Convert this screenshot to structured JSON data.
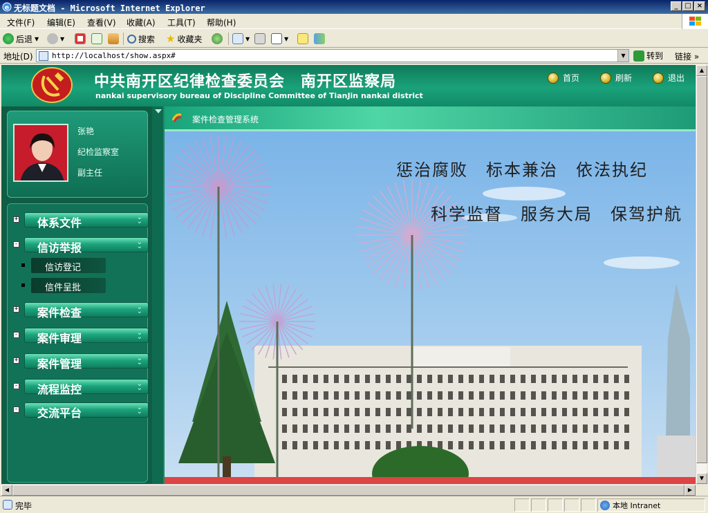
{
  "window": {
    "title": "无标题文档 - Microsoft Internet Explorer",
    "min": "_",
    "max": "□",
    "close": "×"
  },
  "menu": [
    "文件(F)",
    "编辑(E)",
    "查看(V)",
    "收藏(A)",
    "工具(T)",
    "帮助(H)"
  ],
  "toolbar": {
    "back": "后退",
    "search": "搜索",
    "favorites": "收藏夹"
  },
  "address": {
    "label": "地址(D)",
    "url": "http://localhost/show.aspx#",
    "go": "转到",
    "links": "链接"
  },
  "header": {
    "title_cn": "中共南开区纪律检查委员会　南开区监察局",
    "title_en": "nankai supervisory bureau of Discipline Committee of TianJin nankai district",
    "nav": [
      "首页",
      "刷新",
      "退出"
    ]
  },
  "profile": {
    "name": "张艳",
    "department": "纪检监察室",
    "position": "副主任"
  },
  "nav_categories": [
    {
      "label": "体系文件",
      "toggle": "+"
    },
    {
      "label": "信访举报",
      "toggle": "-"
    },
    {
      "label": "案件检查",
      "toggle": "+"
    },
    {
      "label": "案件审理",
      "toggle": "-"
    },
    {
      "label": "案件管理",
      "toggle": "+"
    },
    {
      "label": "流程监控",
      "toggle": "-"
    },
    {
      "label": "交流平台",
      "toggle": "-"
    }
  ],
  "nav_subitems": [
    "信访登记",
    "信件呈批"
  ],
  "content": {
    "tab_title": "案件检查管理系统",
    "slogan_line1": "惩治腐败　标本兼治　依法执纪",
    "slogan_line2": "科学监督　服务大局　保驾护航"
  },
  "status": {
    "text": "完毕",
    "zone": "本地 Intranet"
  },
  "colors": {
    "banner_green": "#1aa27a",
    "panel_green": "#0e5d44",
    "xp_chrome": "#ece9d8",
    "titlebar_blue": "#0a246a"
  }
}
